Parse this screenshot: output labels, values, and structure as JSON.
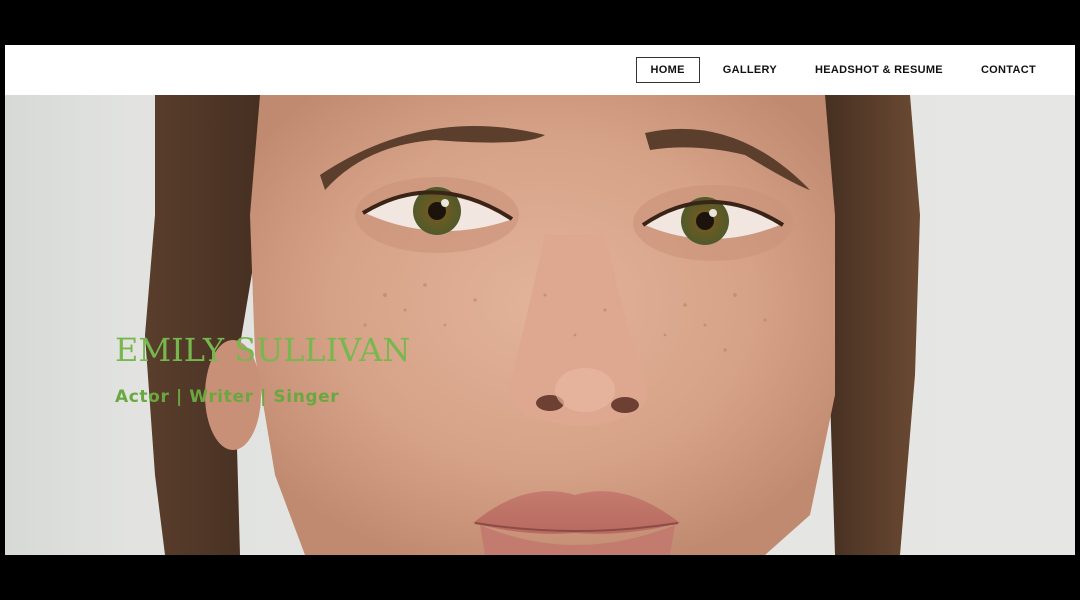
{
  "nav": {
    "items": [
      {
        "label": "HOME",
        "active": true
      },
      {
        "label": "GALLERY",
        "active": false
      },
      {
        "label": "HEADSHOT & RESUME",
        "active": false
      },
      {
        "label": "CONTACT",
        "active": false
      }
    ]
  },
  "hero": {
    "title": "EMILY SULLIVAN",
    "subtitle": "Actor | Writer | Singer",
    "accent_color": "#77b84e",
    "image_subject": "close-up portrait photo"
  }
}
